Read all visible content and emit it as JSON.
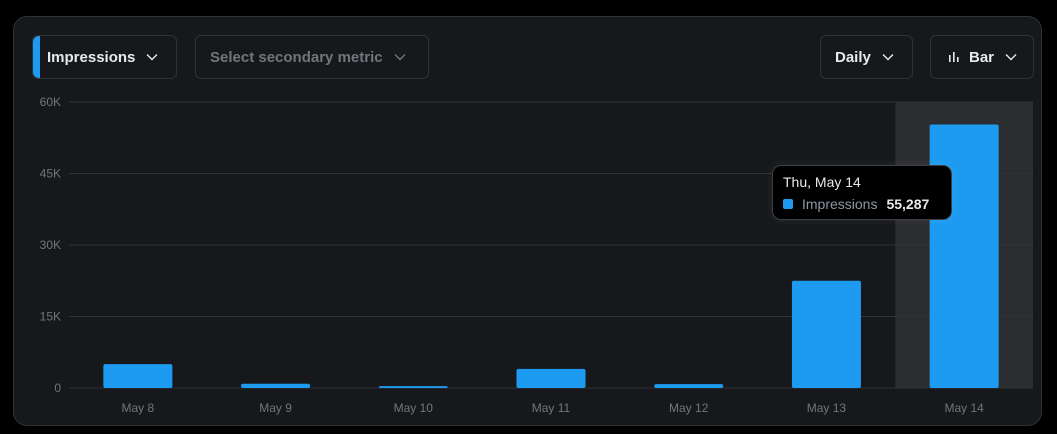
{
  "controls": {
    "primary_metric": "Impressions",
    "secondary_metric_placeholder": "Select secondary metric",
    "interval": "Daily",
    "chart_type": "Bar"
  },
  "tooltip": {
    "date": "Thu, May 14",
    "series": "Impressions",
    "value": "55,287"
  },
  "colors": {
    "accent": "#1d9bf0",
    "background": "#16181c",
    "grid": "#2f3336",
    "highlight": "#2c2d31"
  },
  "chart_data": {
    "type": "bar",
    "categories": [
      "May 8",
      "May 9",
      "May 10",
      "May 11",
      "May 12",
      "May 13",
      "May 14"
    ],
    "series": [
      {
        "name": "Impressions",
        "values": [
          5000,
          900,
          400,
          4000,
          800,
          22500,
          55287
        ]
      }
    ],
    "ylim": [
      0,
      60000
    ],
    "yticks": [
      0,
      15000,
      30000,
      45000,
      60000
    ],
    "ytick_labels": [
      "0",
      "15K",
      "30K",
      "45K",
      "60K"
    ],
    "highlighted_category": "May 14",
    "grid": true
  }
}
